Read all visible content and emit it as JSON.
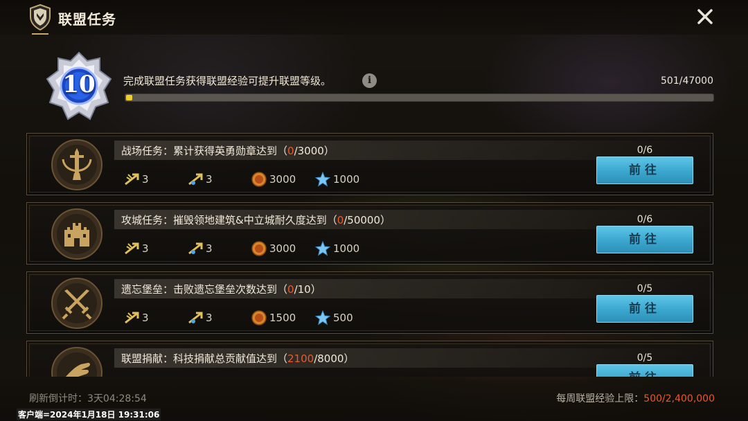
{
  "window": {
    "title": "联盟任务"
  },
  "header": {
    "level": "10",
    "description": "完成联盟任务获得联盟经验可提升联盟等级。",
    "xp_text": "501/47000",
    "xp_progress": 0.0107
  },
  "tasks": [
    {
      "icon": "sword-emblem-icon",
      "title_prefix": "战场任务：累计获得英勇勋章达到（",
      "current": "0",
      "title_suffix": "/3000）",
      "rewards": [
        "3",
        "3",
        "3000",
        "1000"
      ],
      "count": "0/6",
      "button": "前往"
    },
    {
      "icon": "castle-icon",
      "title_prefix": "攻城任务：摧毁领地建筑&中立城耐久度达到（",
      "current": "0",
      "title_suffix": "/50000）",
      "rewards": [
        "3",
        "3",
        "3000",
        "1000"
      ],
      "count": "0/6",
      "button": "前往"
    },
    {
      "icon": "crossed-swords-icon",
      "title_prefix": "遗忘堡垒：击败遗忘堡垒次数达到（",
      "current": "0",
      "title_suffix": "/10）",
      "rewards": [
        "3",
        "3",
        "1500",
        "500"
      ],
      "count": "0/5",
      "button": "前往"
    },
    {
      "icon": "hand-icon",
      "title_prefix": "联盟捐献：科技捐献总贡献值达到（",
      "current": "2100",
      "title_suffix": "/8000）",
      "rewards": [],
      "count": "0/5",
      "button": "前往"
    }
  ],
  "reward_icons": [
    "wing-arrow-icon",
    "wing-arrow-blue-icon",
    "coin-icon",
    "star-icon"
  ],
  "footer": {
    "refresh_label": "刷新倒计时：",
    "refresh_time": "3天04:28:54",
    "weekly_label": "每周联盟经验上限：",
    "weekly_value": "500/2,400,000",
    "client_stamp": "客户端=2024年1月18日 19:31:06"
  },
  "colors": {
    "accent_button": "#3aa6cf",
    "progress_fill": "#f1cf2a",
    "highlight": "#ea5a2a"
  }
}
